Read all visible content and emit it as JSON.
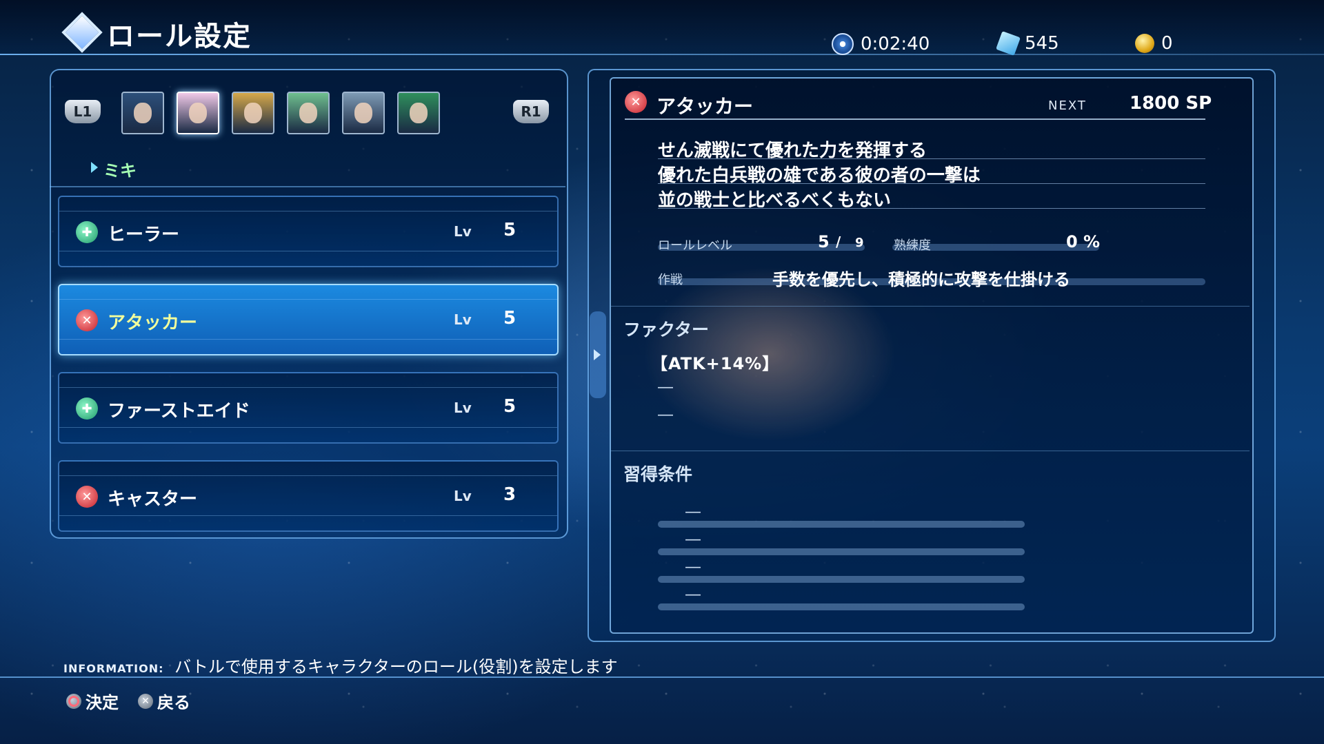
{
  "header": {
    "title": "ロール設定",
    "time": "0:02:40",
    "crystals": "545",
    "coins": "0"
  },
  "left": {
    "l1_label": "L1",
    "r1_label": "R1",
    "selected_character": "ミキ",
    "portrait_colors": [
      "#2d4f7a",
      "#f1c9e7",
      "#d6a84a",
      "#6fbf8e",
      "#7e9ab4",
      "#2f8f5c"
    ],
    "roles": [
      {
        "name": "ヒーラー",
        "lv_label": "Lv",
        "level": "5",
        "icon": "healer-icon"
      },
      {
        "name": "アタッカー",
        "lv_label": "Lv",
        "level": "5",
        "icon": "attacker-icon"
      },
      {
        "name": "ファーストエイド",
        "lv_label": "Lv",
        "level": "5",
        "icon": "healer-icon"
      },
      {
        "name": "キャスター",
        "lv_label": "Lv",
        "level": "3",
        "icon": "attacker-icon"
      }
    ]
  },
  "detail": {
    "role_name": "アタッカー",
    "next_label": "NEXT",
    "next_value": "1800 SP",
    "description": [
      "せん滅戦にて優れた力を発揮する",
      "優れた白兵戦の雄である彼の者の一撃は",
      "並の戦士と比べるべくもない"
    ],
    "role_level_label": "ロールレベル",
    "role_level_value": "5",
    "role_level_sep": "/",
    "role_level_max": "9",
    "proficiency_label": "熟練度",
    "proficiency_value": "0 %",
    "strategy_label": "作戦",
    "strategy_value": "手数を優先し、積極的に攻撃を仕掛ける",
    "factor_title": "ファクター",
    "factors": [
      "【ATK+14%】",
      "―",
      "―"
    ],
    "condition_title": "習得条件",
    "conditions": [
      "―",
      "―",
      "―",
      "―"
    ]
  },
  "footer": {
    "info_tag": "INFORMATION:",
    "info_text": "バトルで使用するキャラクターのロール(役割)を設定します",
    "confirm_label": "決定",
    "back_label": "戻る"
  },
  "colors": {
    "accent": "#1c8ae0",
    "selected_text": "#f3ff9c",
    "char_name": "#a6ffb4",
    "attacker_icon": "#c41f2a",
    "healer_icon": "#1f9a6b"
  }
}
